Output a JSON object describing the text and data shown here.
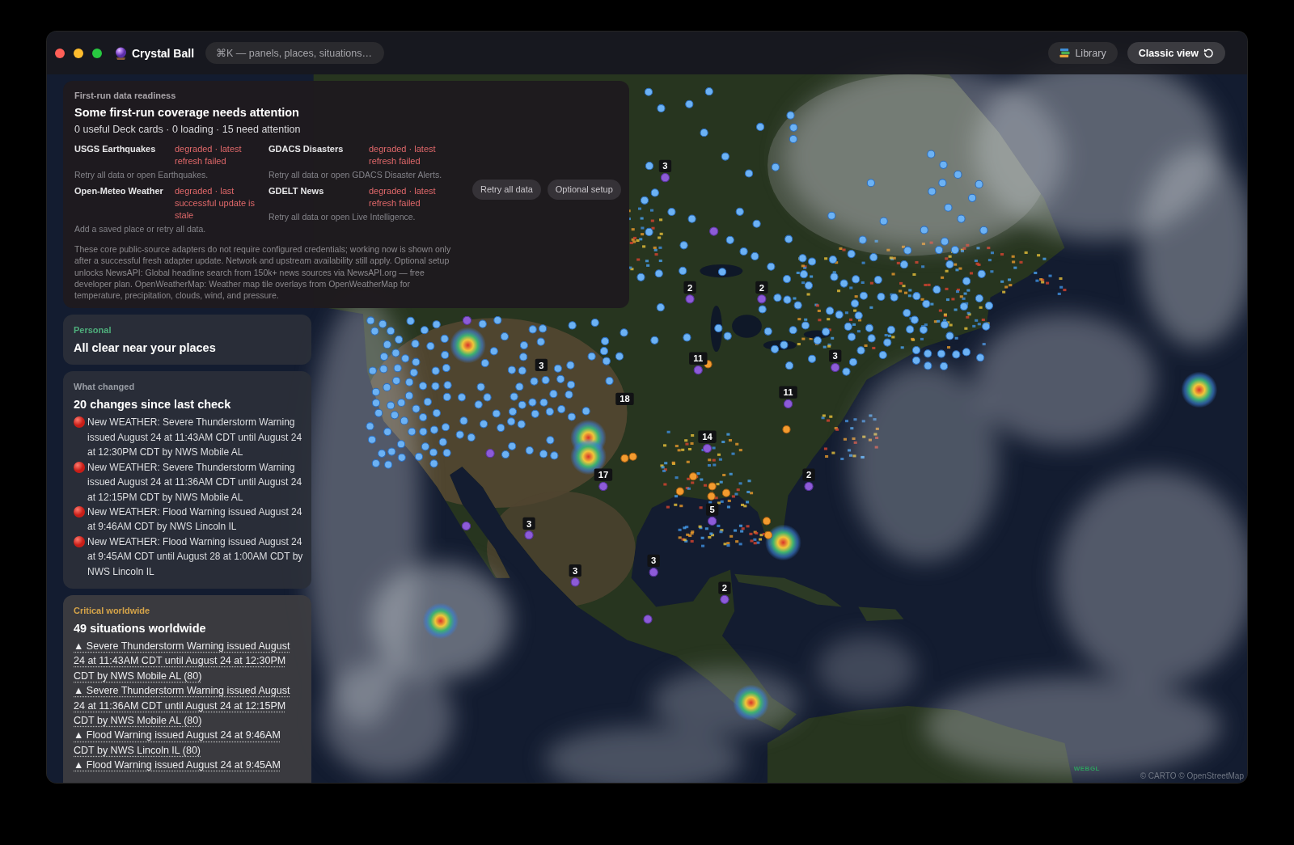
{
  "window": {
    "title": "Crystal Ball"
  },
  "toolbar": {
    "command_search": {
      "placeholder": "⌘K — panels, places, situations…"
    },
    "buttons": [
      {
        "kind": "library",
        "label": "Library"
      },
      {
        "kind": "classic",
        "label": "Classic view"
      }
    ]
  },
  "readiness": {
    "eyebrow": "First-run data readiness",
    "title": "Some first-run coverage needs attention",
    "summary": "0 useful Deck cards · 0 loading · 15 need attention",
    "sources": [
      {
        "name": "USGS Earthquakes",
        "status": "degraded · latest refresh failed",
        "hint": "Retry all data or open Earthquakes."
      },
      {
        "name": "GDACS Disasters",
        "status": "degraded · latest refresh failed",
        "hint": "Retry all data or open GDACS Disaster Alerts."
      },
      {
        "name": "Open-Meteo Weather",
        "status": "degraded · last successful update is stale",
        "hint": "Add a saved place or retry all data."
      },
      {
        "name": "GDELT News",
        "status": "degraded · latest refresh failed",
        "hint": "Retry all data or open Live Intelligence."
      }
    ],
    "actions": [
      "Retry all data",
      "Optional setup"
    ],
    "note": "These core public-source adapters do not require configured credentials; working now is shown only after a successful fresh adapter update. Network and upstream availability still apply. Optional setup unlocks NewsAPI: Global headline search from 150k+ news sources via NewsAPI.org — free developer plan. OpenWeatherMap: Weather map tile overlays from OpenWeatherMap for temperature, precipitation, clouds, wind, and pressure."
  },
  "cards": [
    {
      "kind": "personal",
      "eyebrow": "Personal",
      "color": "#4fae7c",
      "title": "All clear near your places"
    },
    {
      "kind": "changes",
      "eyebrow": "What changed",
      "color": "#9a9ea6",
      "title": "20 changes since last check",
      "items": [
        "New WEATHER: Severe Thunderstorm Warning issued August 24 at 11:43AM CDT until August 24 at 12:30PM CDT by NWS Mobile AL",
        "New WEATHER: Severe Thunderstorm Warning issued August 24 at 11:36AM CDT until August 24 at 12:15PM CDT by NWS Mobile AL",
        "New WEATHER: Flood Warning issued August 24 at 9:46AM CDT by NWS Lincoln IL",
        "New WEATHER: Flood Warning issued August 24 at 9:45AM CDT until August 28 at 1:00AM CDT by NWS Lincoln IL"
      ]
    },
    {
      "kind": "critical",
      "eyebrow": "Critical worldwide",
      "color": "#d6a449",
      "title": "49 situations worldwide",
      "links": [
        "▲ Severe Thunderstorm Warning issued August 24 at 11:43AM CDT until August 24 at 12:30PM CDT by NWS Mobile AL (80)",
        "▲ Severe Thunderstorm Warning issued August 24 at 11:36AM CDT until August 24 at 12:15PM CDT by NWS Mobile AL (80)",
        "▲ Flood Warning issued August 24 at 9:46AM CDT by NWS Lincoln IL (80)",
        "▲ Flood Warning issued August 24 at 9:45AM"
      ]
    }
  ],
  "map": {
    "clusters": [
      {
        "count": "3"
      },
      {
        "count": "2"
      },
      {
        "count": "2"
      },
      {
        "count": "3"
      },
      {
        "count": "11"
      },
      {
        "count": "3"
      },
      {
        "count": "11"
      },
      {
        "count": "18"
      },
      {
        "count": "14"
      },
      {
        "count": "2"
      },
      {
        "count": "17"
      },
      {
        "count": "5"
      },
      {
        "count": "3"
      },
      {
        "count": "3"
      },
      {
        "count": "3"
      },
      {
        "count": "2"
      }
    ],
    "renderer": "WEBGL",
    "attribution": "© CARTO © OpenStreetMap"
  }
}
